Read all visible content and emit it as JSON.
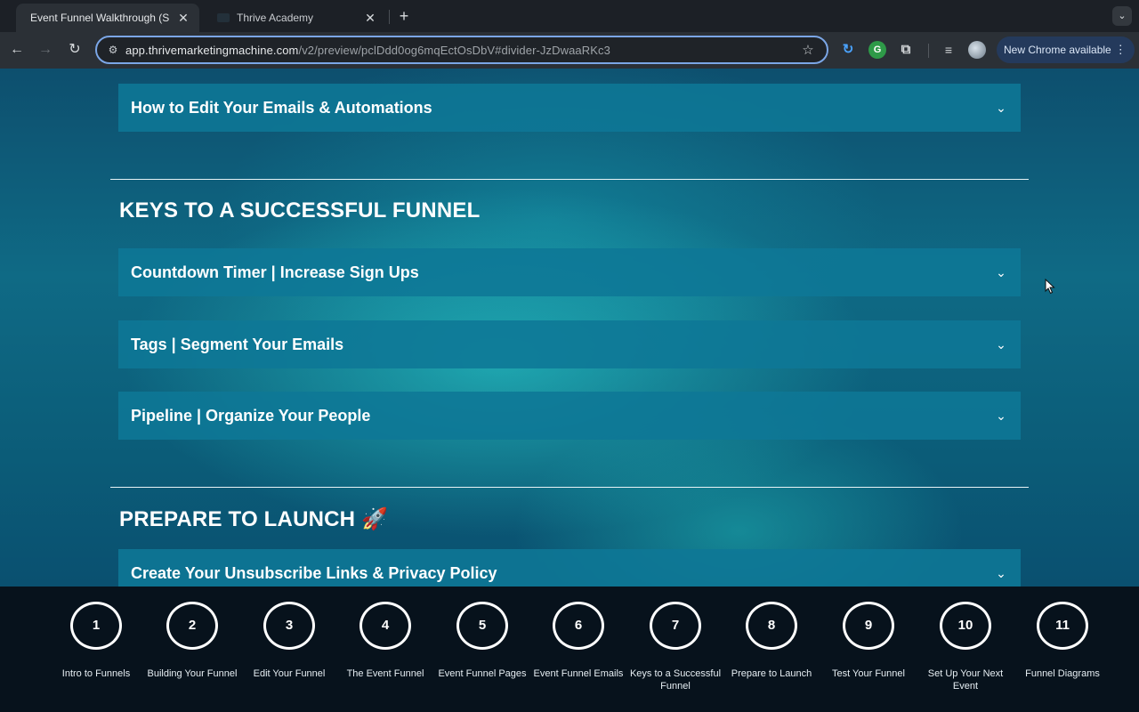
{
  "browser": {
    "tabs": [
      {
        "title": "Event Funnel Walkthrough (S",
        "active": true
      },
      {
        "title": "Thrive Academy",
        "active": false
      }
    ],
    "url_host": "app.thrivemarketingmachine.com",
    "url_path": "/v2/preview/pclDdd0og6mqEctOsDbV#divider-JzDwaaRKc3",
    "update_label": "New Chrome available"
  },
  "page": {
    "top_accordion": "How to Edit Your Emails & Automations",
    "section_keys": {
      "heading": "KEYS TO A SUCCESSFUL FUNNEL",
      "items": [
        "Countdown Timer | Increase Sign Ups",
        "Tags | Segment Your Emails",
        "Pipeline | Organize Your People"
      ]
    },
    "section_launch": {
      "heading": "PREPARE TO LAUNCH 🚀",
      "items": [
        "Create Your Unsubscribe Links & Privacy Policy"
      ]
    }
  },
  "steps": [
    {
      "num": "1",
      "label": "Intro to Funnels"
    },
    {
      "num": "2",
      "label": "Building Your Funnel"
    },
    {
      "num": "3",
      "label": "Edit Your Funnel"
    },
    {
      "num": "4",
      "label": "The Event Funnel"
    },
    {
      "num": "5",
      "label": "Event Funnel Pages"
    },
    {
      "num": "6",
      "label": "Event Funnel Emails"
    },
    {
      "num": "7",
      "label": "Keys to a Successful Funnel"
    },
    {
      "num": "8",
      "label": "Prepare to Launch"
    },
    {
      "num": "9",
      "label": "Test Your Funnel"
    },
    {
      "num": "10",
      "label": "Set Up Your Next Event"
    },
    {
      "num": "11",
      "label": "Funnel Diagrams"
    }
  ]
}
